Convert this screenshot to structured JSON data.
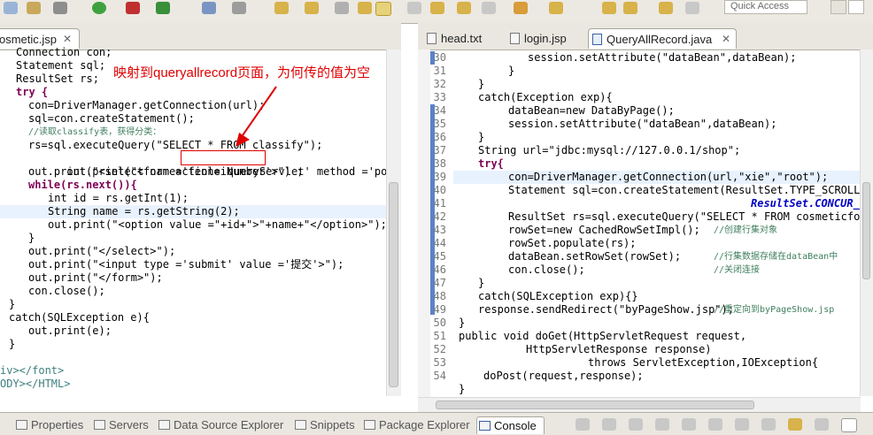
{
  "toolbar": {
    "quick_access": "Quick Access"
  },
  "annotation": {
    "text": "映射到queryallrecord页面，为何传的值为空"
  },
  "left_editor": {
    "tab": "osmetic.jsp",
    "lines": [
      "Connection con;",
      "Statement sql;",
      "ResultSet rs;",
      "try {",
      "con=DriverManager.getConnection(url);",
      "sql=con.createStatement();",
      "//读取classify表，获得分类：",
      "rs=sql.executeQuery(\"SELECT * FROM classify\");",
      "out.print(\"<form action=",
      "queryServlet'",
      " method ='post'>\") ;",
      "out.print(\"<select name='fenleiNumber'>\") ;",
      "while(rs.next()){",
      "int id = rs.getInt(1);",
      "String name = rs.getString(2);",
      "out.print(\"<option value =\"+id+\">\"+name+\"</option>\");",
      "}",
      "out.print(\"</select>\");",
      "out.print(\"<input type ='submit' value ='提交'>\");",
      "out.print(\"</form>\");",
      "con.close();",
      "}",
      "catch(SQLException e){",
      "out.print(e);",
      "}",
      "iv></font>",
      "ODY></HTML>"
    ]
  },
  "right_editor": {
    "tabs": [
      "head.txt",
      "login.jsp",
      "QueryAllRecord.java"
    ],
    "line_numbers": [
      "30",
      "31",
      "32",
      "33",
      "34",
      "35",
      "36",
      "37",
      "38",
      "39",
      "40",
      "41",
      "42",
      "43",
      "44",
      "45",
      "46",
      "47",
      "48",
      "49",
      "50",
      "51",
      "52",
      "53",
      "54"
    ],
    "lines": [
      "session.setAttribute(\"dataBean\",dataBean);",
      "}",
      "}",
      "catch(Exception exp){",
      "dataBean=new DataByPage();",
      "session.setAttribute(\"dataBean\",dataBean);",
      "}",
      "String url=\"jdbc:mysql://127.0.0.1/shop\";",
      "try{",
      "con=DriverManager.getConnection(url,\"xie\",\"root\");",
      "Statement sql=con.createStatement(ResultSet.TYPE_SCROLL_S",
      "ResultSet.CONCUR_REA",
      "ResultSet rs=sql.executeQuery(\"SELECT * FROM cosmeticform",
      "rowSet=new CachedRowSetImpl();",
      "//创建行集对象",
      "rowSet.populate(rs);",
      "dataBean.setRowSet(rowSet);",
      "//行集数据存储在dataBean中",
      "con.close();",
      "//关闭连接",
      "}",
      "catch(SQLException exp){}",
      "response.sendRedirect(\"byPageShow.jsp\");",
      "//重定向到byPageShow.jsp",
      "}",
      "public void doGet(HttpServletRequest request,",
      "HttpServletResponse response)",
      "throws ServletException,IOException{",
      "doPost(request,response);",
      "}"
    ]
  },
  "bottom_tabs": [
    "s",
    "Properties",
    "Servers",
    "Data Source Explorer",
    "Snippets",
    "Package Explorer",
    "Console"
  ]
}
